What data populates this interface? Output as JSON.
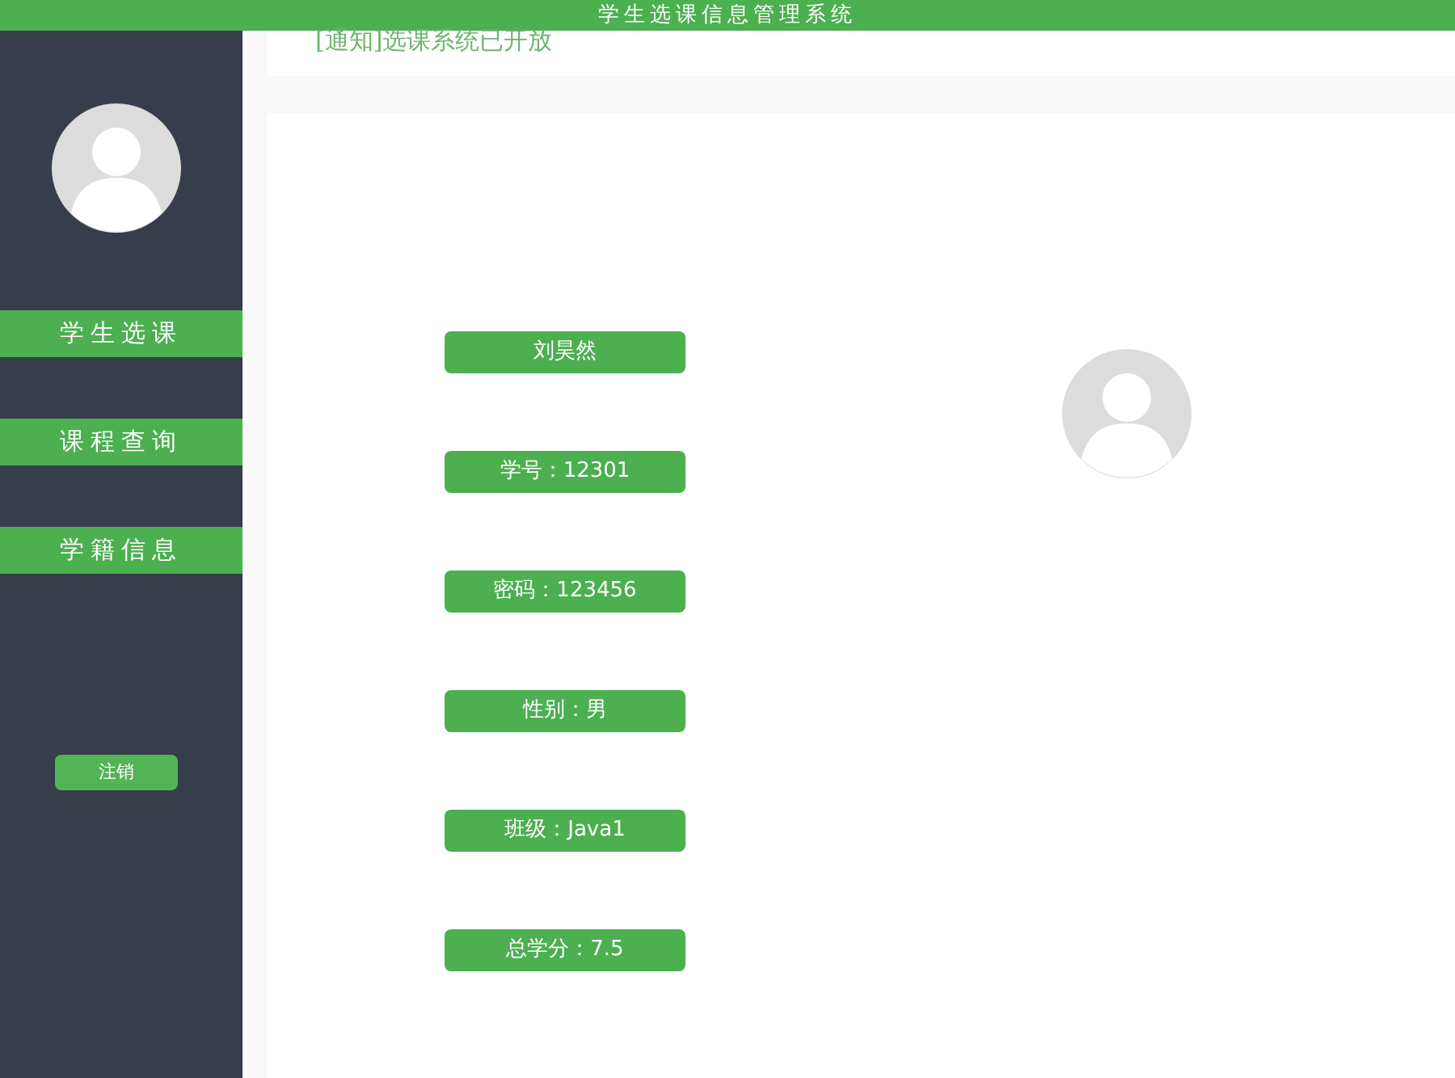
{
  "header": {
    "title": "学生选课信息管理系统"
  },
  "notice": "[通知]选课系统已开放",
  "sidebar": {
    "items": [
      "学生选课",
      "课程查询",
      "学籍信息"
    ],
    "logout": "注销"
  },
  "profile": {
    "fields": [
      "刘昊然",
      "学号：12301",
      "密码：123456",
      "性别：男",
      "班级：Java1",
      "总学分：7.5"
    ]
  }
}
